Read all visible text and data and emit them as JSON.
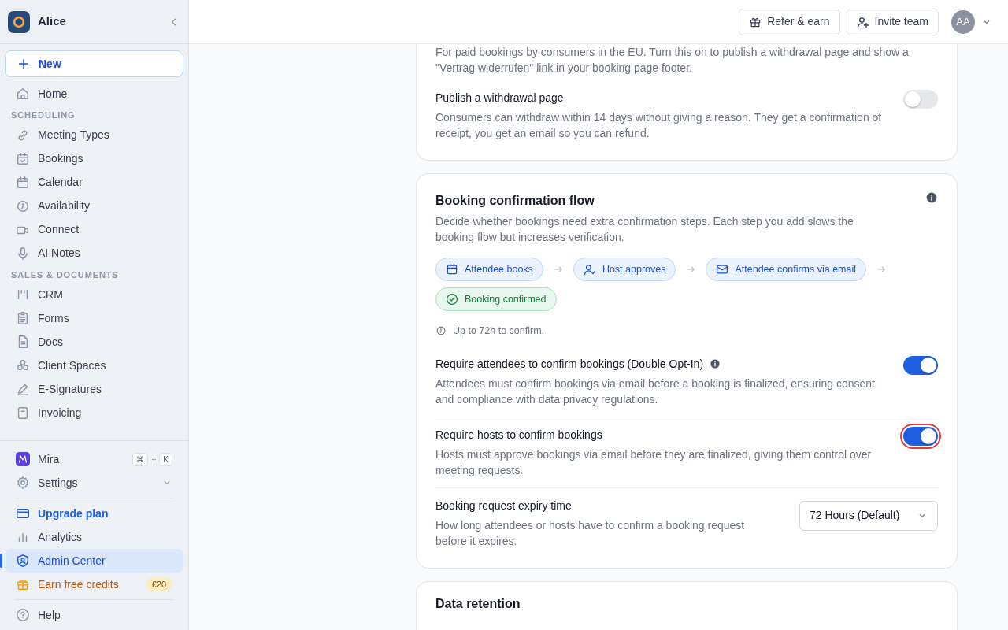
{
  "sidebar": {
    "workspace": "Alice",
    "new_button": "New",
    "nav": [
      {
        "kind": "item",
        "label": "Home"
      },
      {
        "kind": "heading",
        "label": "SCHEDULING"
      },
      {
        "kind": "item",
        "label": "Meeting Types"
      },
      {
        "kind": "item",
        "label": "Bookings"
      },
      {
        "kind": "item",
        "label": "Calendar"
      },
      {
        "kind": "item",
        "label": "Availability"
      },
      {
        "kind": "item",
        "label": "Connect"
      },
      {
        "kind": "item",
        "label": "AI Notes"
      },
      {
        "kind": "heading",
        "label": "SALES & DOCUMENTS"
      },
      {
        "kind": "item",
        "label": "CRM"
      },
      {
        "kind": "item",
        "label": "Forms"
      },
      {
        "kind": "item",
        "label": "Docs"
      },
      {
        "kind": "item",
        "label": "Client Spaces"
      },
      {
        "kind": "item",
        "label": "E-Signatures"
      },
      {
        "kind": "item",
        "label": "Invoicing"
      }
    ],
    "assistant": {
      "label": "Mira",
      "keys": [
        "⌘",
        "K"
      ],
      "joiner": "+"
    },
    "settings": {
      "label": "Settings"
    },
    "bottom": [
      {
        "kind": "upgrade",
        "label": "Upgrade plan",
        "selected": false
      },
      {
        "kind": "item",
        "label": "Analytics",
        "selected": false
      },
      {
        "kind": "item",
        "label": "Admin Center",
        "selected": true
      },
      {
        "kind": "credits",
        "label": "Earn free credits",
        "badge": "€20",
        "selected": false
      }
    ],
    "help": "Help"
  },
  "header": {
    "buttons": [
      "Refer & earn",
      "Invite team"
    ],
    "avatar": "AA"
  },
  "cards": [
    {
      "intro": "For paid bookings by consumers in the EU. Turn this on to publish a withdrawal page and show a \"Vertrag widerrufen\" link in your booking page footer.",
      "settings": [
        {
          "kind": "toggle",
          "title": "Publish a withdrawal page",
          "description": "Consumers can withdraw within 14 days without giving a reason. They get a confirmation of receipt, you get an email so you can refund.",
          "on": false,
          "focused": false
        }
      ]
    },
    {
      "title": "Booking confirmation flow",
      "description": "Decide whether bookings need extra confirmation steps. Each step you add slows the booking flow but increases verification.",
      "flow": [
        {
          "kind": "step",
          "label": "Attendee books"
        },
        {
          "kind": "step",
          "label": "Host approves"
        },
        {
          "kind": "step",
          "label": "Attendee confirms via email"
        },
        {
          "kind": "done",
          "label": "Booking confirmed"
        }
      ],
      "note": "Up to 72h to confirm.",
      "settings": [
        {
          "kind": "toggle",
          "title": "Require attendees to confirm bookings (Double Opt-In)",
          "info": true,
          "description": "Attendees must confirm bookings via email before a booking is finalized, ensuring consent and compliance with data privacy regulations.",
          "on": true,
          "focused": false
        },
        {
          "kind": "toggle",
          "title": "Require hosts to confirm bookings",
          "description": "Hosts must approve bookings via email before they are finalized, giving them control over meeting requests.",
          "on": true,
          "focused": true
        },
        {
          "kind": "select",
          "title": "Booking request expiry time",
          "description": "How long attendees or hosts have to confirm a booking request before it expires.",
          "value": "72 Hours (Default)"
        }
      ]
    },
    {
      "title": "Data retention"
    }
  ]
}
